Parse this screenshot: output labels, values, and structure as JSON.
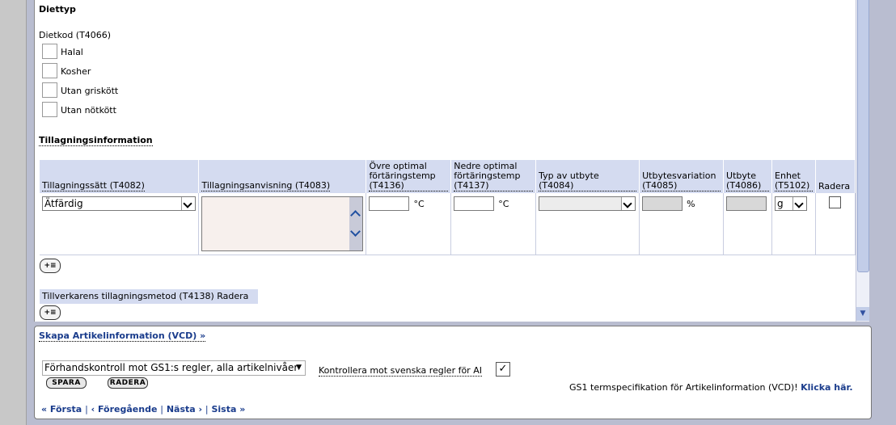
{
  "diet": {
    "title": "Diettyp",
    "code_label": "Dietkod (T4066)",
    "options": [
      "Halal",
      "Kosher",
      "Utan griskött",
      "Utan nötkött"
    ]
  },
  "preparation": {
    "title": "Tillagningsinformation",
    "headers": [
      "Tillagningssätt (T4082)",
      "Tillagningsanvisning (T4083)",
      "Övre optimal förtäringstemp (T4136)",
      "Nedre optimal förtäringstemp (T4137)",
      "Typ av utbyte (T4084)",
      "Utbytesvariation (T4085)",
      "Utbyte (T4086)",
      "Enhet (T5102)",
      "Radera"
    ],
    "row": {
      "method": "Ätfärdig",
      "instruction": "",
      "upper_temp": "",
      "upper_unit": "°C",
      "lower_temp": "",
      "lower_unit": "°C",
      "yield_type": "",
      "variation_unit": "%",
      "unit": "g"
    },
    "add_icon": "add-row-icon"
  },
  "manufacturer": {
    "label": "Tillverkarens tillagningsmetod (T4138)",
    "delete_label": "Radera"
  },
  "footer": {
    "create_link": "Skapa Artikelinformation (VCD) »",
    "precheck_select": "Förhandskontroll mot GS1:s regler, alla artikelnivåer",
    "save_btn": "SPARA",
    "delete_btn": "RADERA",
    "swedish_rules_label": "Kontrollera mot svenska regler för AI",
    "swedish_rules_checked": true,
    "spec_text": "GS1 termspecifikation för Artikelinformation (VCD)!",
    "spec_link": "Klicka här.",
    "nav": {
      "first": "« Första",
      "prev": "‹ Föregående",
      "next": "Nästa ›",
      "last": "Sista »",
      "sep": "|"
    }
  }
}
